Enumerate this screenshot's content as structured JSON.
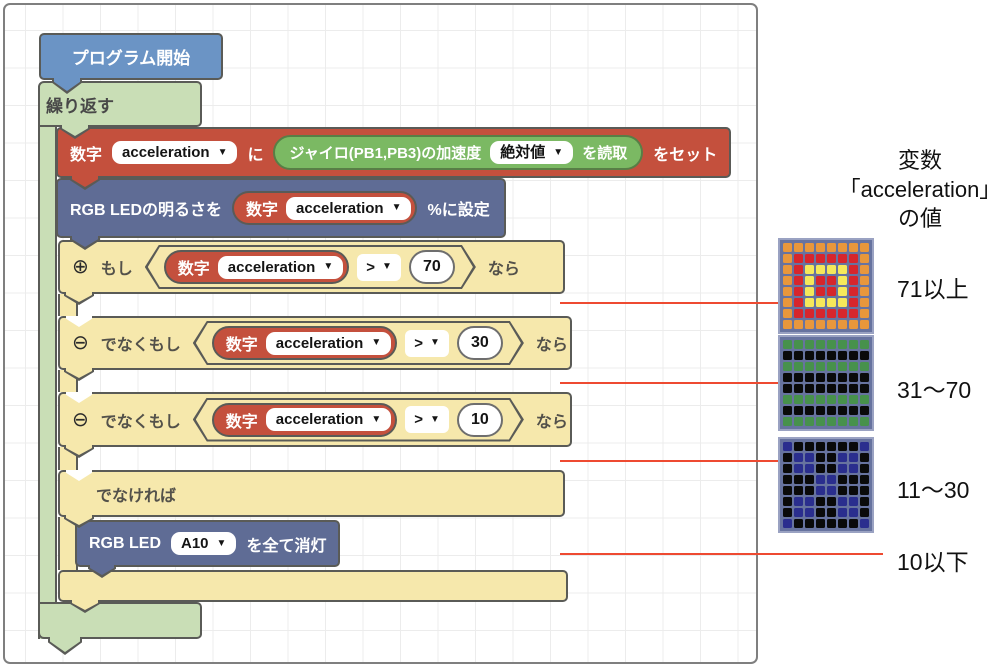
{
  "glyphs": {
    "dropdown_arrow": "▼"
  },
  "workspace": {
    "start_label": "プログラム開始",
    "repeat_label": "繰り返す",
    "set_block": {
      "num_label": "数字",
      "var_name": "acceleration",
      "particle": "に",
      "gyro_label": "ジャイロ(PB1,PB3)の加速度",
      "abs_label": "絶対値",
      "read_label": "を読取",
      "set_label": "をセット"
    },
    "brightness_block": {
      "prefix": "RGB LEDの明るさを",
      "num_label": "数字",
      "var_name": "acceleration",
      "suffix": "%に設定"
    },
    "if_rows": [
      {
        "icon": "⊕",
        "keyword": "もし",
        "num_label": "数字",
        "var_name": "acceleration",
        "operator": ">",
        "value": "70",
        "suffix": "なら"
      },
      {
        "icon": "⊖",
        "keyword": "でなくもし",
        "num_label": "数字",
        "var_name": "acceleration",
        "operator": ">",
        "value": "30",
        "suffix": "なら"
      },
      {
        "icon": "⊖",
        "keyword": "でなくもし",
        "num_label": "数字",
        "var_name": "acceleration",
        "operator": ">",
        "value": "10",
        "suffix": "なら"
      }
    ],
    "else_label": "でなければ",
    "led_off_block": {
      "prefix": "RGB LED",
      "port": "A10",
      "suffix": "を全て消灯"
    }
  },
  "panel": {
    "title_lines": [
      "変数",
      "「acceleration」",
      "の値"
    ],
    "range_labels": [
      "71以上",
      "31〜70",
      "11〜30",
      "10以下"
    ],
    "matrices": [
      {
        "palette": {
          "O": "#E8973B",
          "R": "#D6262C",
          "Y": "#F5E85A"
        },
        "rows": [
          "OOOOOOOO",
          "ORRRRRRO",
          "ORYYYYRO",
          "ORYRRYRO",
          "ORYRRYRO",
          "ORYYYYRO",
          "ORRRRRRO",
          "OOOOOOOO"
        ]
      },
      {
        "palette": {
          "G": "#47914C",
          "K": "#0a0a0a"
        },
        "rows": [
          "GGGGGGGG",
          "KKKKKKKK",
          "GGGGGGGG",
          "KKKKKKKK",
          "KKKKKKKK",
          "GGGGGGGG",
          "KKKKKKKK",
          "GGGGGGGG"
        ]
      },
      {
        "palette": {
          "B": "#2A2E8E",
          "K": "#0a0a0a"
        },
        "rows": [
          "BKKKKKKB",
          "KBBKKBBK",
          "KBBKKBBK",
          "KKKBBKKK",
          "KKKBBKKK",
          "KBBKKBBK",
          "KBBKKBBK",
          "BKKKKKKB"
        ]
      }
    ]
  },
  "colors": {
    "connector_line": "#ee4a31",
    "block_start_blue": "#6B94C5",
    "block_red": "#C4503D",
    "block_dark_blue": "#5F6C95",
    "block_repeat_green": "#C9DEB6",
    "block_inner_green": "#7BB963",
    "block_yellow": "#F6E8AC",
    "matrix_grid": "#67739f"
  }
}
